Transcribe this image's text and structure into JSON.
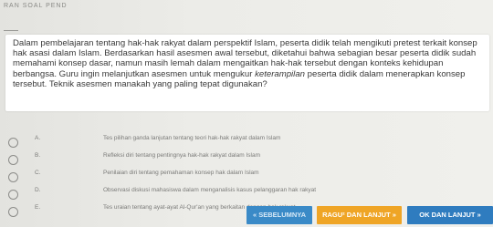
{
  "header": {
    "title": "RAN SOAL PEND"
  },
  "question": {
    "text_before": "Dalam pembelajaran tentang hak-hak rakyat dalam perspektif Islam, peserta didik telah mengikuti pretest terkait konsep hak asasi dalam Islam. Berdasarkan hasil asesmen awal tersebut, diketahui bahwa sebagian besar peserta didik sudah memahami konsep dasar, namun masih lemah dalam mengaitkan hak-hak tersebut dengan konteks kehidupan berbangsa. Guru ingin melanjutkan asesmen untuk mengukur ",
    "text_emphasis": "keterampilan",
    "text_after": " peserta didik dalam menerapkan konsep tersebut. Teknik asesmen manakah yang paling tepat digunakan?"
  },
  "options": [
    {
      "letter": "A.",
      "text": "Tes pilihan ganda lanjutan tentang teori hak-hak rakyat dalam Islam"
    },
    {
      "letter": "B.",
      "text": "Refleksi diri tentang pentingnya hak-hak rakyat dalam Islam"
    },
    {
      "letter": "C.",
      "text": "Penilaian diri tentang pemahaman konsep hak dalam Islam"
    },
    {
      "letter": "D.",
      "text": "Observasi diskusi mahasiswa dalam menganalisis kasus pelanggaran hak rakyat"
    },
    {
      "letter": "E.",
      "text": "Tes uraian tentang ayat-ayat Al-Qur'an yang berkaitan dengan hak rakyat"
    }
  ],
  "nav": {
    "prev_label": "« SEBELUMNYA",
    "doubt_label": "RAGU² DAN LANJUT »",
    "next_label": "OK DAN LANJUT »"
  },
  "colors": {
    "prev_button": "#3a8ac7",
    "doubt_button": "#efa526",
    "next_button": "#2f7cbf"
  }
}
